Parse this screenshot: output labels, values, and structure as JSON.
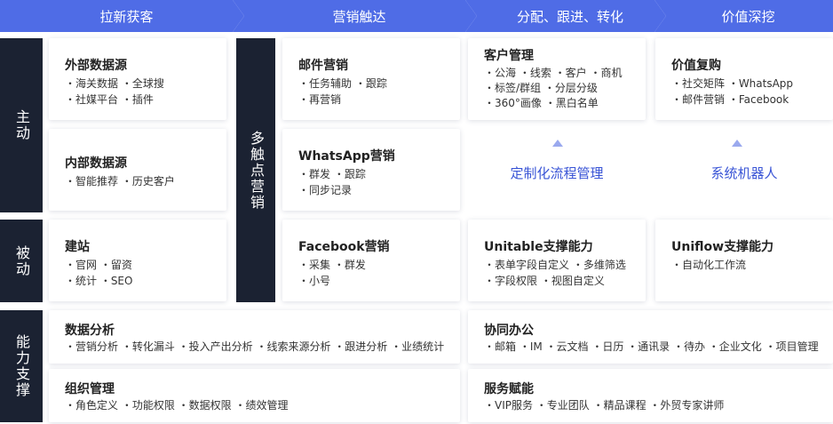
{
  "header": [
    "拉新获客",
    "营销触达",
    "分配、跟进、转化",
    "价值深挖"
  ],
  "side": {
    "active": "主动",
    "passive": "被动",
    "capability": "能力支撑",
    "touch": "多触点营销"
  },
  "cards": {
    "external": {
      "title": "外部数据源",
      "lines": [
        "・海关数据 ・全球搜",
        "・社媒平台 ・插件"
      ]
    },
    "internal": {
      "title": "内部数据源",
      "lines": [
        "・智能推荐 ・历史客户"
      ]
    },
    "site": {
      "title": "建站",
      "lines": [
        "・官网 ・留资",
        "・统计 ・SEO"
      ]
    },
    "email": {
      "title": "邮件营销",
      "lines": [
        "・任务辅助 ・跟踪",
        "・再营销"
      ]
    },
    "whatsapp": {
      "title": "WhatsApp营销",
      "lines": [
        "・群发 ・跟踪",
        "・同步记录"
      ]
    },
    "facebook": {
      "title": "Facebook营销",
      "lines": [
        "・采集 ・群发",
        "・小号"
      ]
    },
    "crm": {
      "title": "客户管理",
      "lines": [
        "・公海 ・线索 ・客户 ・商机",
        "・标签/群组 ・分层分级",
        "・360°画像 ・黑白名单"
      ]
    },
    "value": {
      "title": "价值复购",
      "lines": [
        "・社交矩阵 ・WhatsApp",
        "・邮件营销 ・Facebook"
      ]
    },
    "unitable": {
      "title": "Unitable支撑能力",
      "lines": [
        "・表单字段自定义 ・多维筛选",
        "・字段权限 ・视图自定义"
      ]
    },
    "uniflow": {
      "title": "Uniflow支撑能力",
      "lines": [
        "・自动化工作流"
      ]
    },
    "analysis": {
      "title": "数据分析",
      "lines": [
        "・营销分析 ・转化漏斗 ・投入产出分析 ・线索来源分析 ・跟进分析 ・业绩统计"
      ]
    },
    "org": {
      "title": "组织管理",
      "lines": [
        "・角色定义 ・功能权限 ・数据权限 ・绩效管理"
      ]
    },
    "collab": {
      "title": "协同办公",
      "lines": [
        "・邮箱 ・IM ・云文档 ・日历 ・通讯录 ・待办 ・企业文化 ・项目管理"
      ]
    },
    "service": {
      "title": "服务赋能",
      "lines": [
        "・VIP服务 ・专业团队 ・精品课程 ・外贸专家讲师"
      ]
    }
  },
  "highlights": {
    "flow": "定制化流程管理",
    "robot": "系统机器人"
  }
}
